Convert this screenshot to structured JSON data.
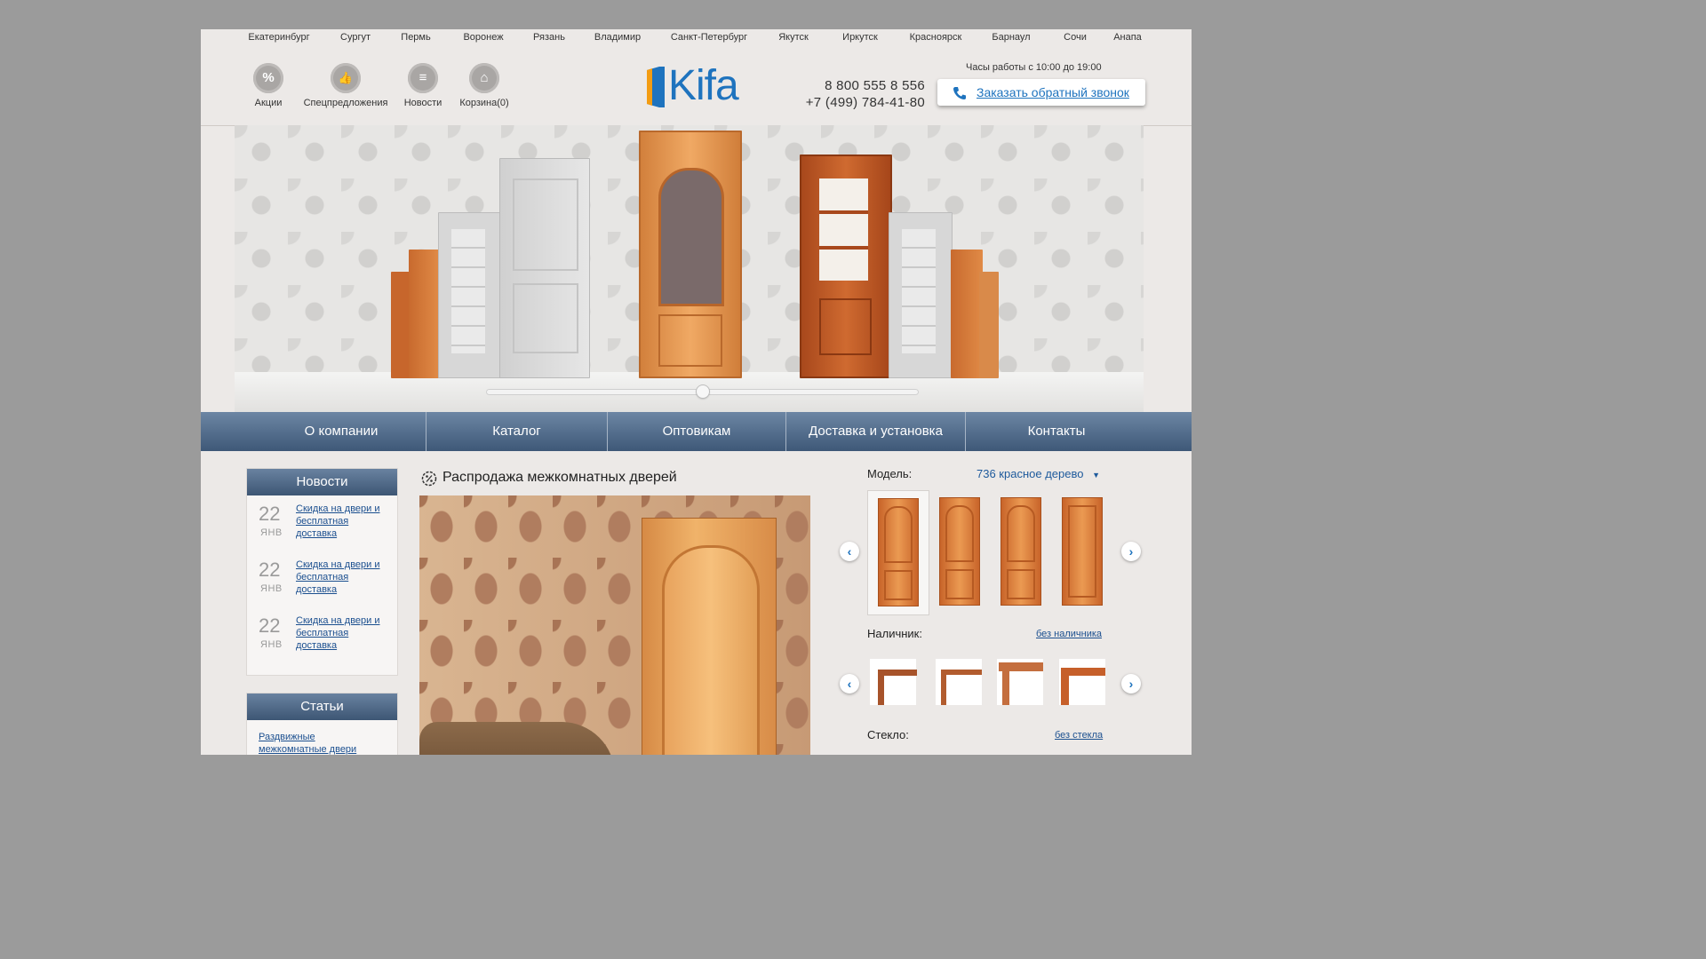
{
  "cities": [
    "Екатеринбург",
    "Сургут",
    "Пермь",
    "Воронеж",
    "Рязань",
    "Владимир",
    "Санкт-Петербург",
    "Якутск",
    "Иркутск",
    "Красноярск",
    "Барнаул",
    "Сочи",
    "Анапа"
  ],
  "header": {
    "icons": [
      {
        "label": "Акции",
        "icon": "percent-icon",
        "glyph": "%"
      },
      {
        "label": "Спецпредложения",
        "icon": "thumbs-up-icon",
        "glyph": "👍"
      },
      {
        "label": "Новости",
        "icon": "news-icon",
        "glyph": "≡"
      },
      {
        "label": "Корзина(0)",
        "icon": "basket-icon",
        "glyph": "⌂"
      }
    ],
    "logo_text": "Kifa",
    "hours": "Часы работы с 10:00 до 19:00",
    "phone1": "8 800 555 8 556",
    "phone2": "+7 (499) 784-41-80",
    "callback_label": "Заказать обратный звонок"
  },
  "hero": {
    "slider_position": 0.5
  },
  "nav": [
    "О компании",
    "Каталог",
    "Оптовикам",
    "Доставка и установка",
    "Контакты"
  ],
  "news": {
    "title": "Новости",
    "items": [
      {
        "day": "22",
        "month": "ЯНВ",
        "text": "Скидка на двери и бесплатная доставка"
      },
      {
        "day": "22",
        "month": "ЯНВ",
        "text": "Скидка на двери и бесплатная доставка"
      },
      {
        "day": "22",
        "month": "ЯНВ",
        "text": "Скидка на двери и бесплатная доставка"
      }
    ]
  },
  "articles": {
    "title": "Статьи",
    "items": [
      {
        "text": "Раздвижные межкомнатные двери"
      }
    ]
  },
  "promo": {
    "title": "Распродажа межкомнатных дверей"
  },
  "config": {
    "model_label": "Модель:",
    "model_value": "736 красное дерево",
    "frame_label": "Наличник:",
    "frame_value": "без наличника",
    "glass_label": "Стекло:",
    "glass_value": "без стекла"
  },
  "colors": {
    "accent": "#1e73be",
    "nav_top": "#6c86a4",
    "nav_bottom": "#3e5878",
    "logo": "#1e73be"
  }
}
